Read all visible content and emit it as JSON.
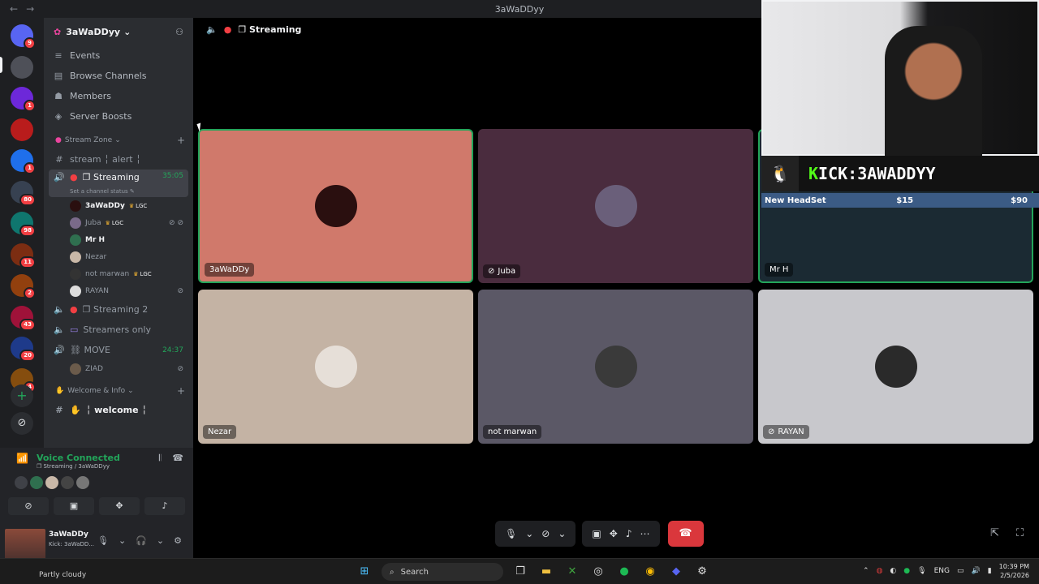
{
  "window": {
    "title": "3aWaDDyy",
    "back": "←",
    "forward": "→"
  },
  "rail": {
    "servers": [
      {
        "name": "discord-home",
        "badge": "9",
        "color": "#5865f2"
      },
      {
        "name": "server-1",
        "badge": "",
        "color": "#4e5058"
      },
      {
        "name": "server-2",
        "badge": "1",
        "color": "#6d28d9"
      },
      {
        "name": "server-3",
        "badge": "",
        "color": "#b91c1c"
      },
      {
        "name": "server-4",
        "badge": "1",
        "color": "#1f6feb"
      },
      {
        "name": "server-5",
        "badge": "80",
        "color": "#374151"
      },
      {
        "name": "server-6",
        "badge": "98",
        "color": "#0f766e"
      },
      {
        "name": "server-7",
        "badge": "11",
        "color": "#7c2d12"
      },
      {
        "name": "server-8",
        "badge": "2",
        "color": "#92400e"
      },
      {
        "name": "server-9",
        "badge": "43",
        "color": "#9f1239"
      },
      {
        "name": "server-10",
        "badge": "20",
        "color": "#1e3a8a"
      },
      {
        "name": "server-11",
        "badge": "4",
        "color": "#854d0e"
      }
    ],
    "add": "+",
    "discover": "⊘"
  },
  "sidebar": {
    "server_name": "3aWaDDyy",
    "server_chevron": "⌄",
    "nav": [
      {
        "icon": "≡",
        "label": "Events"
      },
      {
        "icon": "▤",
        "label": "Browse Channels"
      },
      {
        "icon": "☗",
        "label": "Members"
      },
      {
        "icon": "◈",
        "label": "Server Boosts"
      }
    ],
    "categories": {
      "stream_zone": "Stream Zone",
      "welcome_info": "Welcome & Info"
    },
    "text_channel_1": "stream ╎ alert ╎",
    "active_channel": {
      "name": "❐ Streaming",
      "time": "35:05",
      "status": "Set a channel status ✎"
    },
    "users": [
      {
        "name": "3aWaDDy",
        "tag": "LGC",
        "bold": true,
        "mute": ""
      },
      {
        "name": "Juba",
        "tag": "LGC",
        "bold": false,
        "mute": "⊘ ⊘"
      },
      {
        "name": "Mr H",
        "tag": "",
        "bold": true,
        "mute": ""
      },
      {
        "name": "Nezar",
        "tag": "",
        "bold": false,
        "mute": ""
      },
      {
        "name": "not marwan",
        "tag": "LGC",
        "bold": false,
        "mute": ""
      },
      {
        "name": "RAYAN",
        "tag": "",
        "bold": false,
        "mute": "⊘"
      }
    ],
    "channel_streaming2": "❐ Streaming 2",
    "channel_streamers_only": "Streamers only",
    "channel_move": {
      "name": "⛓ MOVE",
      "time": "24:37"
    },
    "move_user": {
      "name": "ZIAD",
      "mute": "⊘"
    },
    "welcome_channel": "╎ welcome ╎"
  },
  "voice": {
    "title": "Voice Connected",
    "subtitle": "❐ Streaming / 3aWaDDyy",
    "account_name": "3aWaDDy",
    "account_status": "Kick: 3aWaDD...",
    "weather": "Partly cloudy"
  },
  "stage": {
    "header": "❐ Streaming",
    "tiles": [
      {
        "name": "3aWaDDy",
        "bg": "#d0796b",
        "avatar": "#2a0f0f",
        "icon": "",
        "speaking": true
      },
      {
        "name": "Juba",
        "bg": "#4a2c3e",
        "avatar": "#6a5f7a",
        "icon": "⊘",
        "speaking": false
      },
      {
        "name": "Mr H",
        "bg": "#1b2a33",
        "avatar": "#222",
        "icon": "",
        "speaking": true
      },
      {
        "name": "Nezar",
        "bg": "#c4b3a4",
        "avatar": "#e6dfd8",
        "icon": "",
        "speaking": false
      },
      {
        "name": "not marwan",
        "bg": "#5b5866",
        "avatar": "#3a3a3a",
        "icon": "",
        "speaking": false
      },
      {
        "name": "RAYAN",
        "bg": "#c8c8cc",
        "avatar": "#2a2a2a",
        "icon": "⊘",
        "speaking": false
      }
    ]
  },
  "overlay": {
    "kick_prefix": "K",
    "kick_text": "ICK:3AWADDYY",
    "goal_label": "New HeadSet",
    "goal_mid": "$15",
    "goal_end": "$90",
    "goal_progress": 0.17
  },
  "taskbar": {
    "search": "Search",
    "lang": "ENG",
    "time": "10:39 PM",
    "date": "2/5/2026"
  }
}
